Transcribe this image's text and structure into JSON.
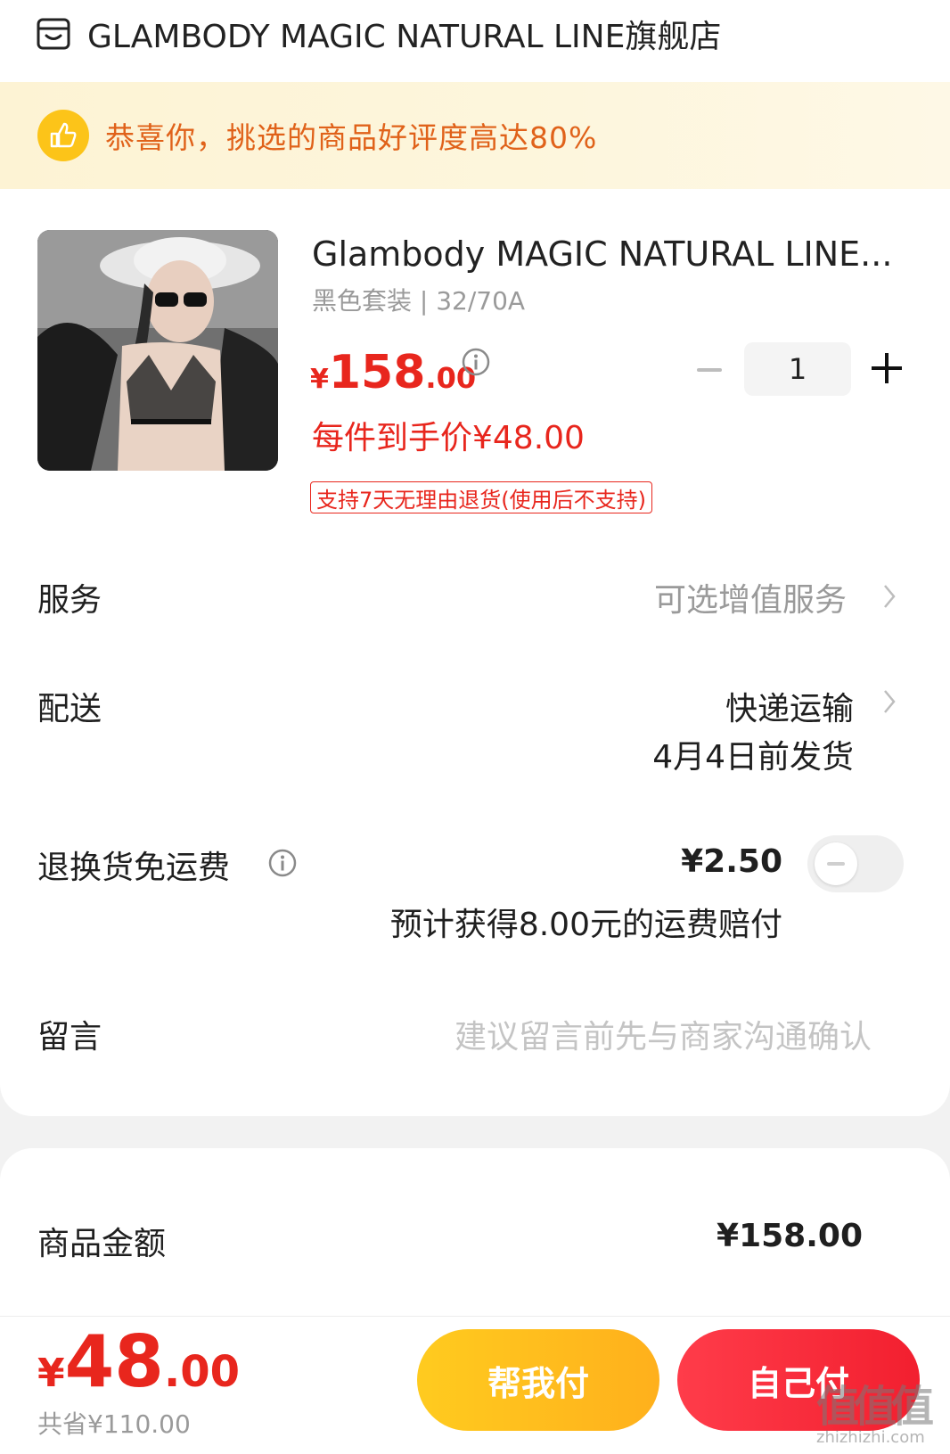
{
  "shop": {
    "name": "GLAMBODY MAGIC NATURAL LINE旗舰店",
    "icon": "store-icon"
  },
  "banner": {
    "text": "恭喜你，挑选的商品好评度高达80%",
    "icon": "thumbs-up-icon",
    "icon_color": "#fcc419",
    "text_color": "#e0621a"
  },
  "product": {
    "title": "Glambody MAGIC NATURAL LINE...",
    "spec": "黑色套装 | 32/70A",
    "price": {
      "symbol": "¥",
      "integer": "158",
      "decimal": ".00"
    },
    "hand_price": "每件到手价¥48.00",
    "return_policy": "支持7天无理由退货(使用后不支持)",
    "quantity": "1"
  },
  "rows": {
    "service": {
      "label": "服务",
      "value": "可选增值服务"
    },
    "delivery": {
      "label": "配送",
      "method": "快递运输",
      "ship_date": "4月4日前发货"
    },
    "return_shipping": {
      "label": "退换货免运费",
      "price": "¥2.50",
      "note": "预计获得8.00元的运费赔付",
      "enabled": false
    },
    "message": {
      "label": "留言",
      "placeholder": "建议留言前先与商家沟通确认"
    }
  },
  "summary": {
    "label": "商品金额",
    "value": "¥158.00"
  },
  "footer": {
    "total": {
      "symbol": "¥",
      "integer": "48",
      "decimal": ".00"
    },
    "saved": "共省¥110.00",
    "help_pay": "帮我付",
    "self_pay": "自己付"
  },
  "watermark": {
    "glyphs": "值值值",
    "site": "zhizhizhi.com"
  },
  "colors": {
    "accent_red": "#e8261d",
    "yellow": "#ffc01e",
    "muted": "#9a9a9a"
  }
}
